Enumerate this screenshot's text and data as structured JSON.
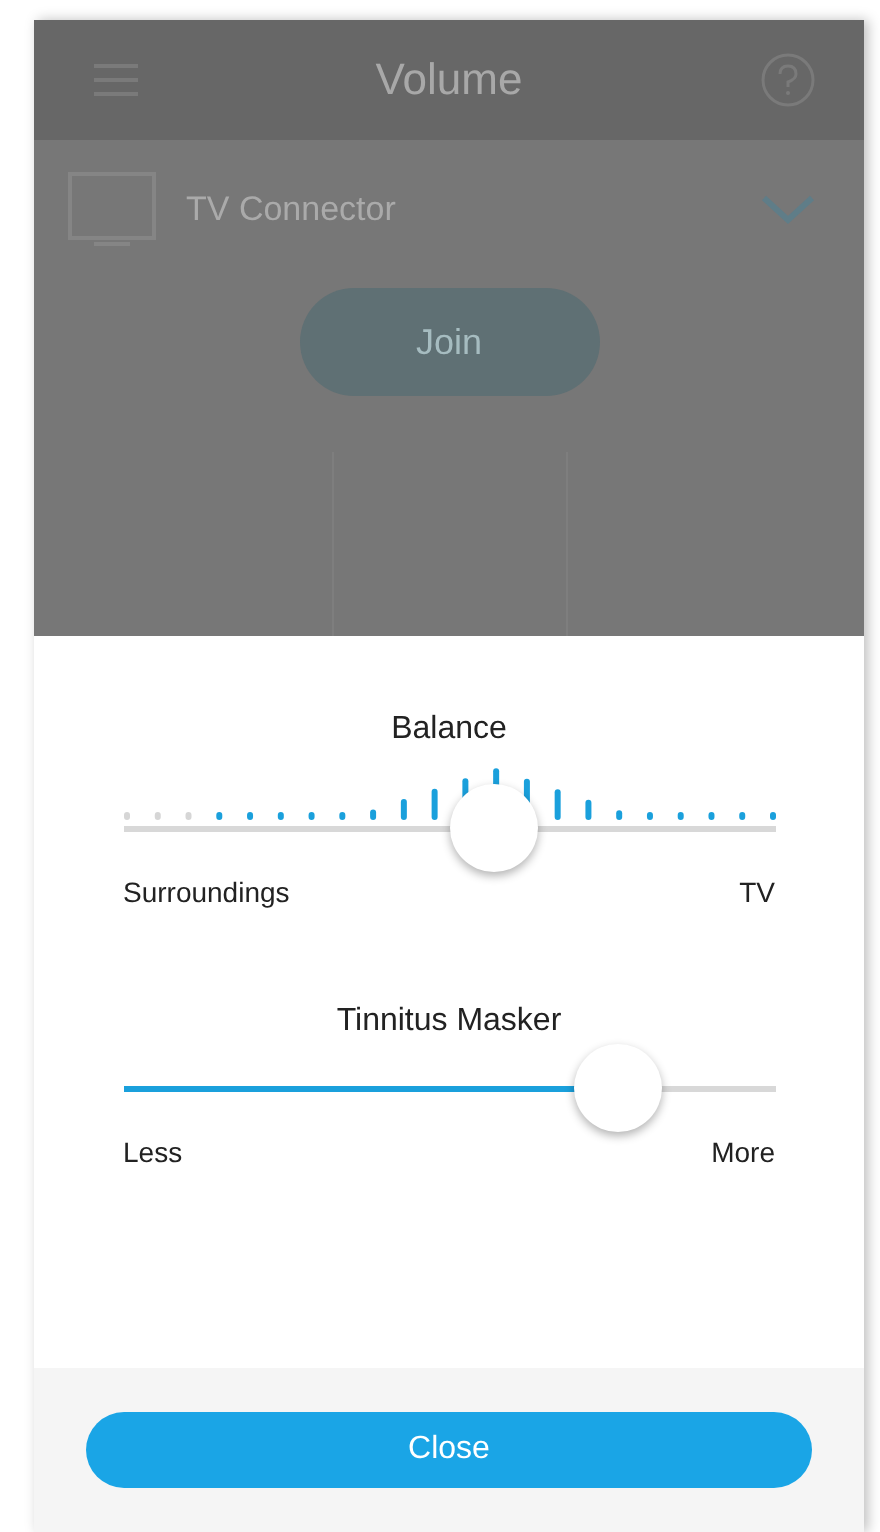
{
  "app_bar": {
    "title": "Volume"
  },
  "device": {
    "name": "TV Connector",
    "expanded": true
  },
  "join_button": {
    "label": "Join"
  },
  "balance": {
    "title": "Balance",
    "level": 0.57,
    "left_label": "Surroundings",
    "right_label": "TV"
  },
  "tinnitus_masker": {
    "title": "Tinnitus Masker",
    "level": 0.76,
    "left_label": "Less",
    "right_label": "More"
  },
  "close_button": {
    "label": "Close"
  }
}
